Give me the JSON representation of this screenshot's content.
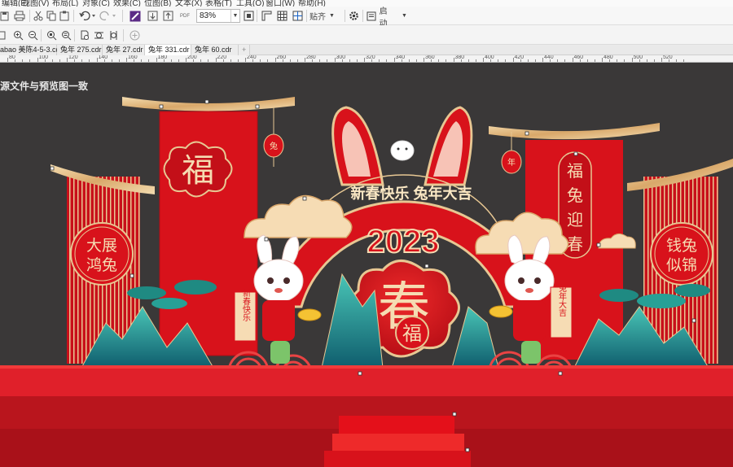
{
  "menu": [
    "编辑(E)",
    "视图(V)",
    "布局(L)",
    "对象(C)",
    "效果(C)",
    "位图(B)",
    "文本(X)",
    "表格(T)",
    "工具(O)",
    "窗口(W)",
    "帮助(H)"
  ],
  "toolbar": {
    "zoom_value": "83%",
    "snap_label": "贴齐",
    "launch_label": "启动",
    "pdf_label": "PDF"
  },
  "tabs": [
    {
      "label": "abao 美陈4-5-3.cdr",
      "active": false
    },
    {
      "label": "兔年 275.cdr",
      "active": false
    },
    {
      "label": "兔年 27.cdr",
      "active": false
    },
    {
      "label": "兔年 331.cdr",
      "active": true
    },
    {
      "label": "兔年 60.cdr",
      "active": false
    }
  ],
  "ruler": [
    "80",
    "100",
    "120",
    "140",
    "160",
    "180",
    "200",
    "220",
    "240",
    "260",
    "280",
    "300",
    "320",
    "340",
    "360",
    "380",
    "400",
    "420",
    "440",
    "460",
    "480",
    "500",
    "520"
  ],
  "canvas": {
    "note": "源文件与预览图一致",
    "artwork": {
      "left_medallion": "福",
      "greeting": "新春快乐  兔年大吉",
      "year": "2023",
      "center_big": "春",
      "center_small": "福",
      "left_round": [
        "大展",
        "鸿兔"
      ],
      "right_round": [
        "钱兔",
        "似锦"
      ],
      "right_banner": [
        "福",
        "兔",
        "迎",
        "春"
      ],
      "left_lantern": "兔",
      "right_lantern": "年",
      "left_scroll": "新春快乐",
      "right_scroll": "兔年大吉"
    }
  },
  "colors": {
    "red": "#d8121b",
    "dark_red": "#b5101a",
    "gold": "#e7c793",
    "canvas_bg": "#3a3838",
    "teal": "#1f8a82"
  }
}
